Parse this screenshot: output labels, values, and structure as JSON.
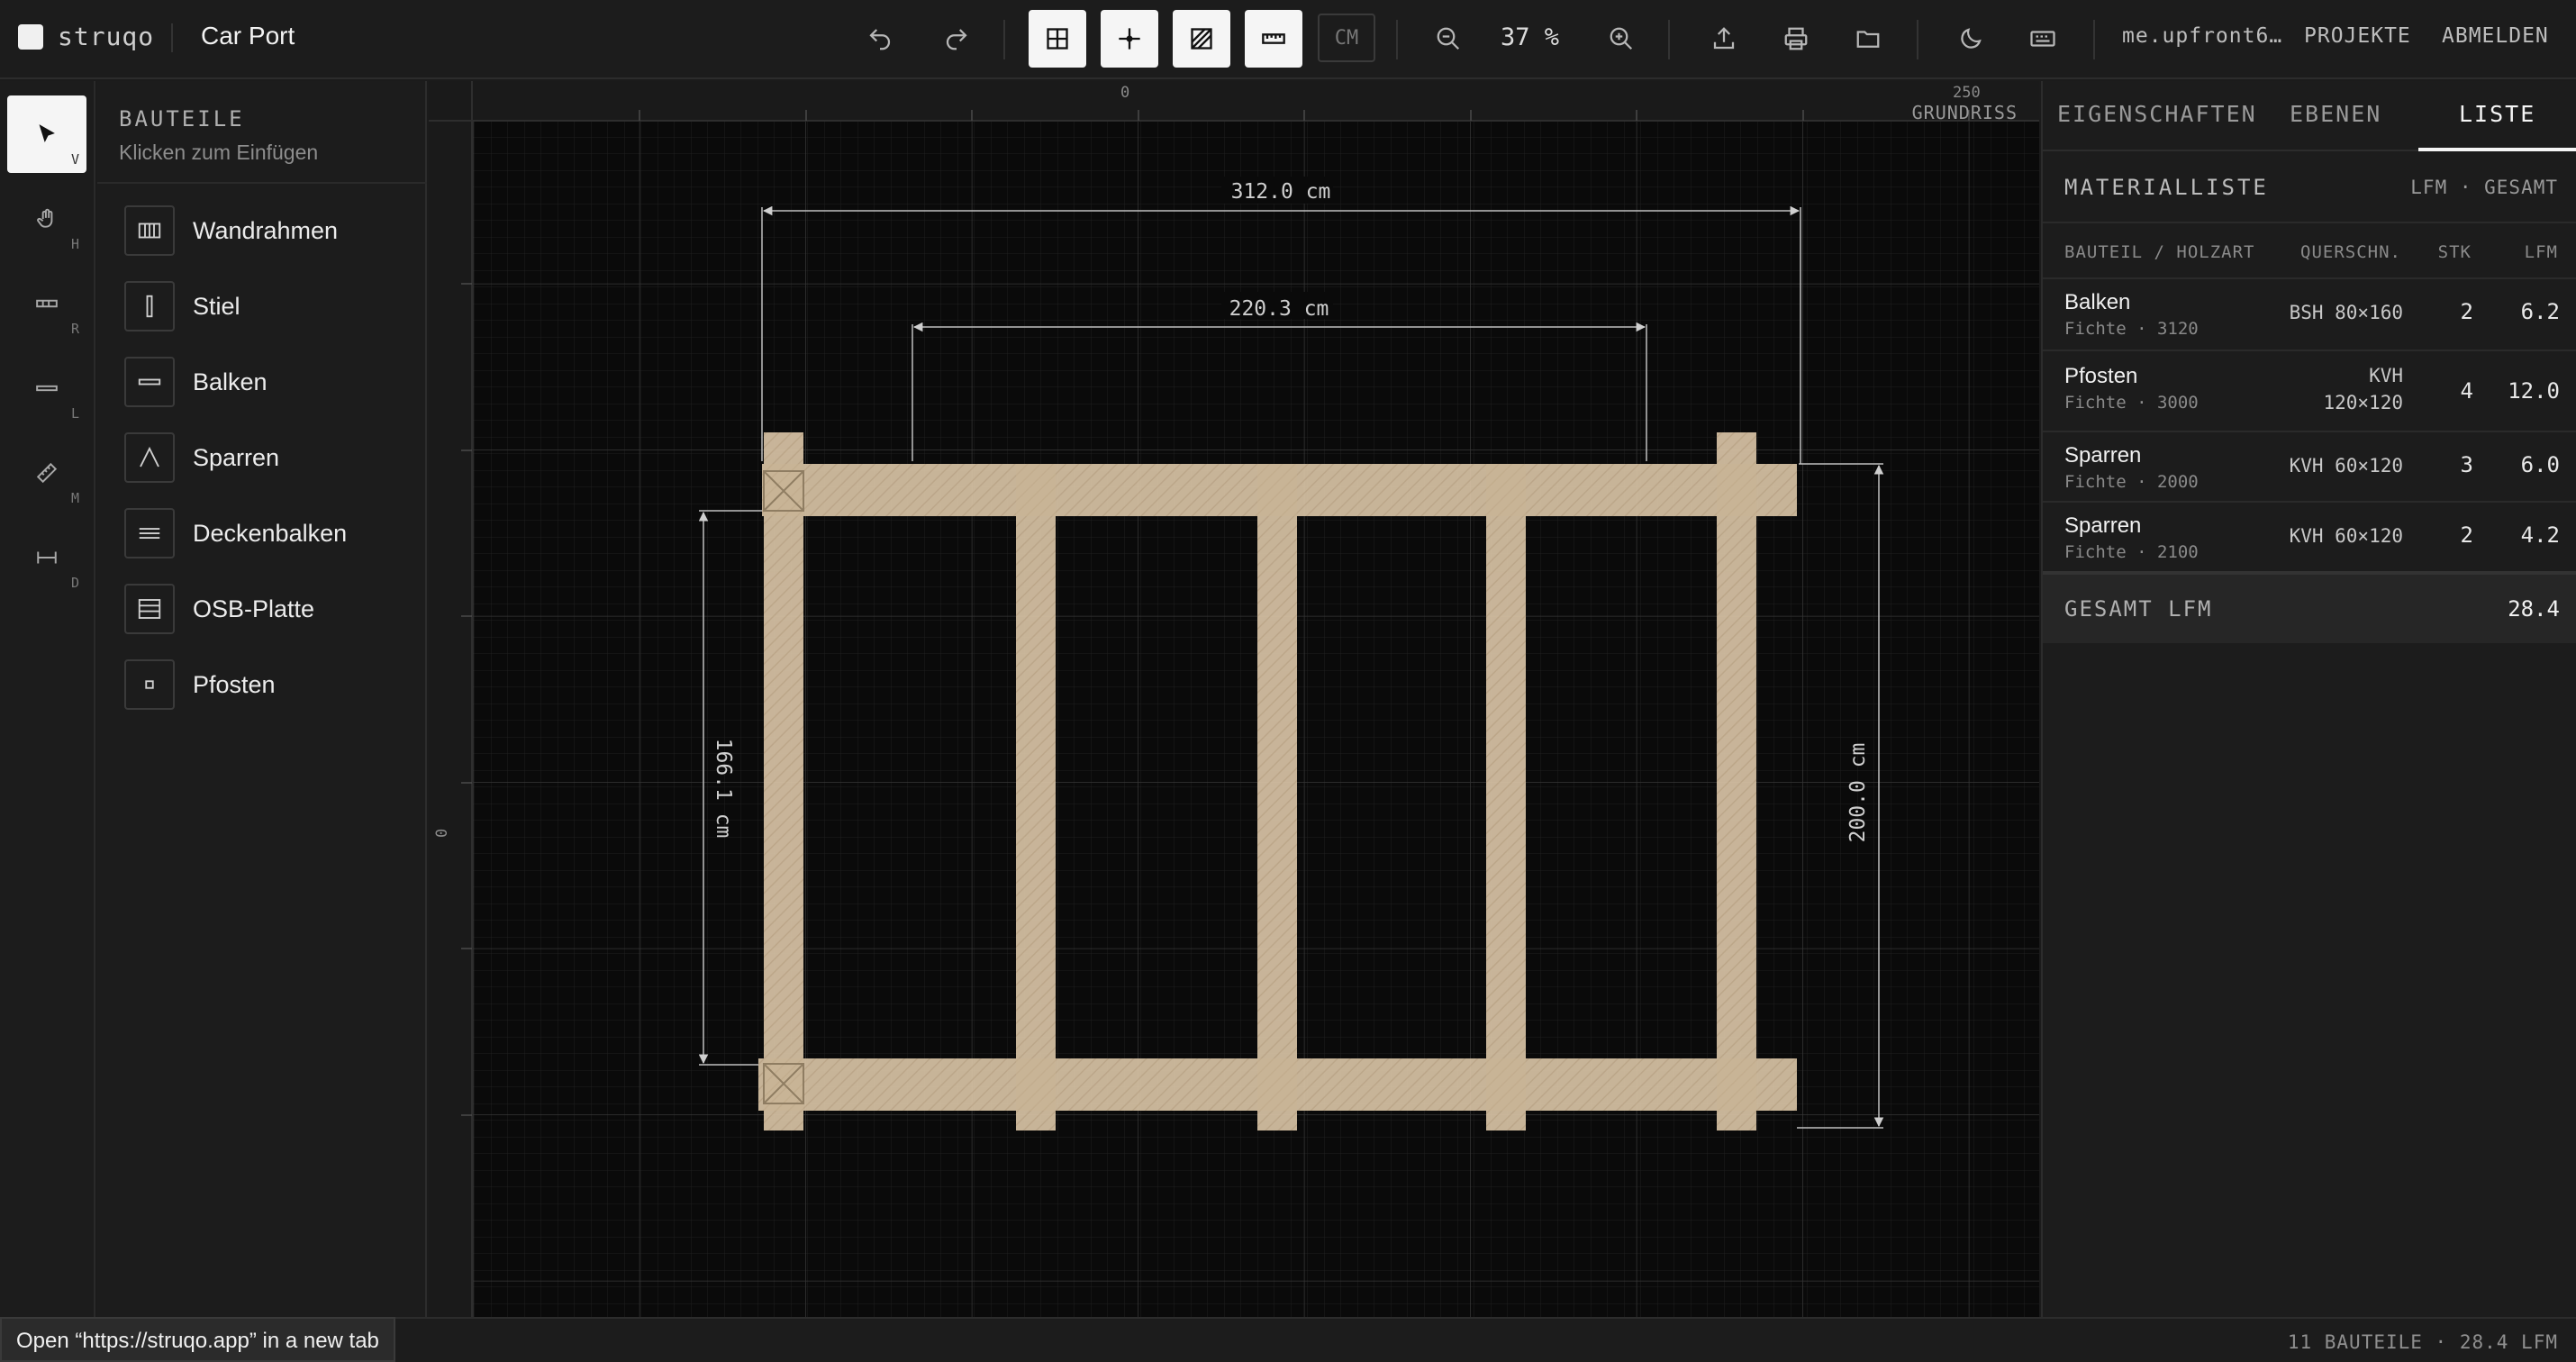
{
  "app": {
    "brand": "struqo",
    "project_title": "Car Port"
  },
  "toolbar": {
    "undo_icon": "undo-icon",
    "redo_icon": "redo-icon",
    "toggles": [
      "grid-icon",
      "snap-crosshair-icon",
      "hatch-icon",
      "ruler-icon"
    ],
    "unit_label": "CM",
    "zoom_out_icon": "zoom-out-icon",
    "zoom_value": "37 %",
    "zoom_in_icon": "zoom-in-icon",
    "actions": [
      "upload-icon",
      "print-icon",
      "folder-icon",
      "moon-icon",
      "keyboard-icon"
    ],
    "user": "me.upfront6…",
    "projects_label": "PROJEKTE",
    "logout_label": "ABMELDEN"
  },
  "tools": [
    {
      "name": "select",
      "icon": "cursor-icon",
      "key": "V",
      "active": true
    },
    {
      "name": "hand",
      "icon": "hand-icon",
      "key": "H",
      "active": false
    },
    {
      "name": "rect",
      "icon": "rect-tool-icon",
      "key": "R",
      "active": false
    },
    {
      "name": "line",
      "icon": "line-tool-icon",
      "key": "L",
      "active": false
    },
    {
      "name": "measure",
      "icon": "measure-icon",
      "key": "M",
      "active": false
    },
    {
      "name": "dimension",
      "icon": "dimension-icon",
      "key": "D",
      "active": false
    }
  ],
  "parts_panel": {
    "title": "BAUTEILE",
    "subtitle": "Klicken zum Einfügen",
    "items": [
      {
        "label": "Wandrahmen",
        "icon": "wall-frame-icon"
      },
      {
        "label": "Stiel",
        "icon": "stud-icon"
      },
      {
        "label": "Balken",
        "icon": "beam-icon"
      },
      {
        "label": "Sparren",
        "icon": "rafter-icon"
      },
      {
        "label": "Deckenbalken",
        "icon": "ceiling-beam-icon"
      },
      {
        "label": "OSB-Platte",
        "icon": "osb-board-icon"
      },
      {
        "label": "Pfosten",
        "icon": "post-icon"
      }
    ]
  },
  "canvas": {
    "ruler_top": [
      "0",
      "250"
    ],
    "ruler_left": [
      "0"
    ],
    "view_label": "GRUNDRISS",
    "dims": {
      "outer_width": "312.0 cm",
      "inner_width": "220.3 cm",
      "left_height": "166.1 cm",
      "right_height": "200.0 cm"
    },
    "colors": {
      "timber": "#d8c3a5",
      "background": "#0a0a0a",
      "grid": "#2a2a2a"
    }
  },
  "right_panel": {
    "tabs": [
      {
        "label": "EIGENSCHAFTEN",
        "active": false
      },
      {
        "label": "EBENEN",
        "active": false
      },
      {
        "label": "LISTE",
        "active": true
      }
    ],
    "material_title": "MATERIALLISTE",
    "unit_mode": "LFM · GESAMT",
    "columns": {
      "part": "BAUTEIL / HOLZART",
      "cross": "QUERSCHN.",
      "qty": "STK",
      "lfm": "LFM"
    },
    "rows": [
      {
        "name": "Balken",
        "wood": "Fichte · 3120",
        "cross": "BSH 80×160",
        "qty": "2",
        "lfm": "6.2"
      },
      {
        "name": "Pfosten",
        "wood": "Fichte · 3000",
        "cross_a": "KVH",
        "cross_b": "120×120",
        "qty": "4",
        "lfm": "12.0"
      },
      {
        "name": "Sparren",
        "wood": "Fichte · 2000",
        "cross": "KVH 60×120",
        "qty": "3",
        "lfm": "6.0"
      },
      {
        "name": "Sparren",
        "wood": "Fichte · 2100",
        "cross": "KVH 60×120",
        "qty": "2",
        "lfm": "4.2"
      }
    ],
    "total_label": "GESAMT LFM",
    "total_value": "28.4"
  },
  "status": {
    "summary": "11 BAUTEILE · 28.4 LFM",
    "link_tooltip": "Open “https://struqo.app” in a new tab"
  }
}
